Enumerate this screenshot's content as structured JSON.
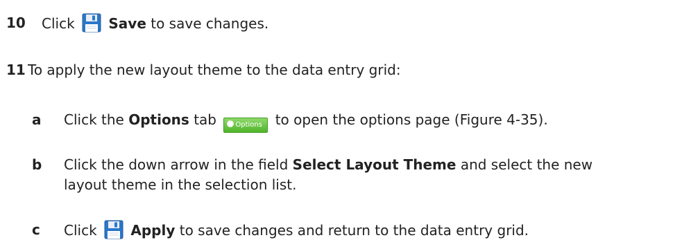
{
  "step10": {
    "number": "10",
    "click": "Click",
    "save_label": "Save",
    "rest": "to save changes."
  },
  "step11": {
    "number": "11",
    "text": "To apply the new layout theme to the data entry grid:"
  },
  "step_a": {
    "letter": "a",
    "click": "Click the",
    "options_label": "Options",
    "tab_word": "tab",
    "tab_button_label": "Options",
    "rest": "to open the options page (Figure 4-35)."
  },
  "step_b": {
    "letter": "b",
    "lead": "Click the down arrow in the field",
    "field_name": "Select Layout Theme",
    "tail": "and select the new",
    "line2": "layout theme in the selection list."
  },
  "step_c": {
    "letter": "c",
    "click": "Click",
    "apply_label": "Apply",
    "rest": "to save changes and return to the data entry grid."
  },
  "icons": {
    "save": "floppy-disk-icon",
    "options": "gear-icon"
  },
  "colors": {
    "save_icon_blue": "#2b77c9",
    "options_green": "#5cc236"
  }
}
